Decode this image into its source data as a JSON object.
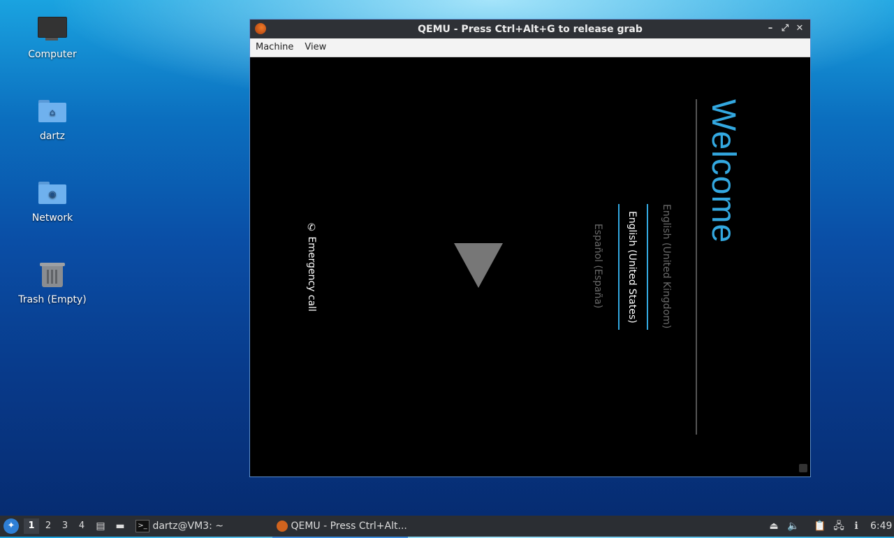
{
  "desktop": {
    "icons": [
      {
        "label": "Computer"
      },
      {
        "label": "dartz"
      },
      {
        "label": "Network"
      },
      {
        "label": "Trash (Empty)"
      }
    ]
  },
  "qemu": {
    "title": "QEMU - Press Ctrl+Alt+G to release grab",
    "menu": [
      "Machine",
      "View"
    ],
    "guest": {
      "welcome": "Welcome",
      "languages": [
        "English (United Kingdom)",
        "English (United States)",
        "Español (España)"
      ],
      "selected_language": "English (United States)",
      "emergency": "Emergency call"
    }
  },
  "taskbar": {
    "workspaces": [
      "1",
      "2",
      "3",
      "4"
    ],
    "active_workspace": "1",
    "tasks": [
      {
        "label": "dartz@VM3: ~"
      },
      {
        "label": "QEMU - Press Ctrl+Alt..."
      }
    ],
    "clock": "6:49"
  },
  "colors": {
    "accent": "#33a8e0",
    "taskbar": "#2b2e33"
  }
}
